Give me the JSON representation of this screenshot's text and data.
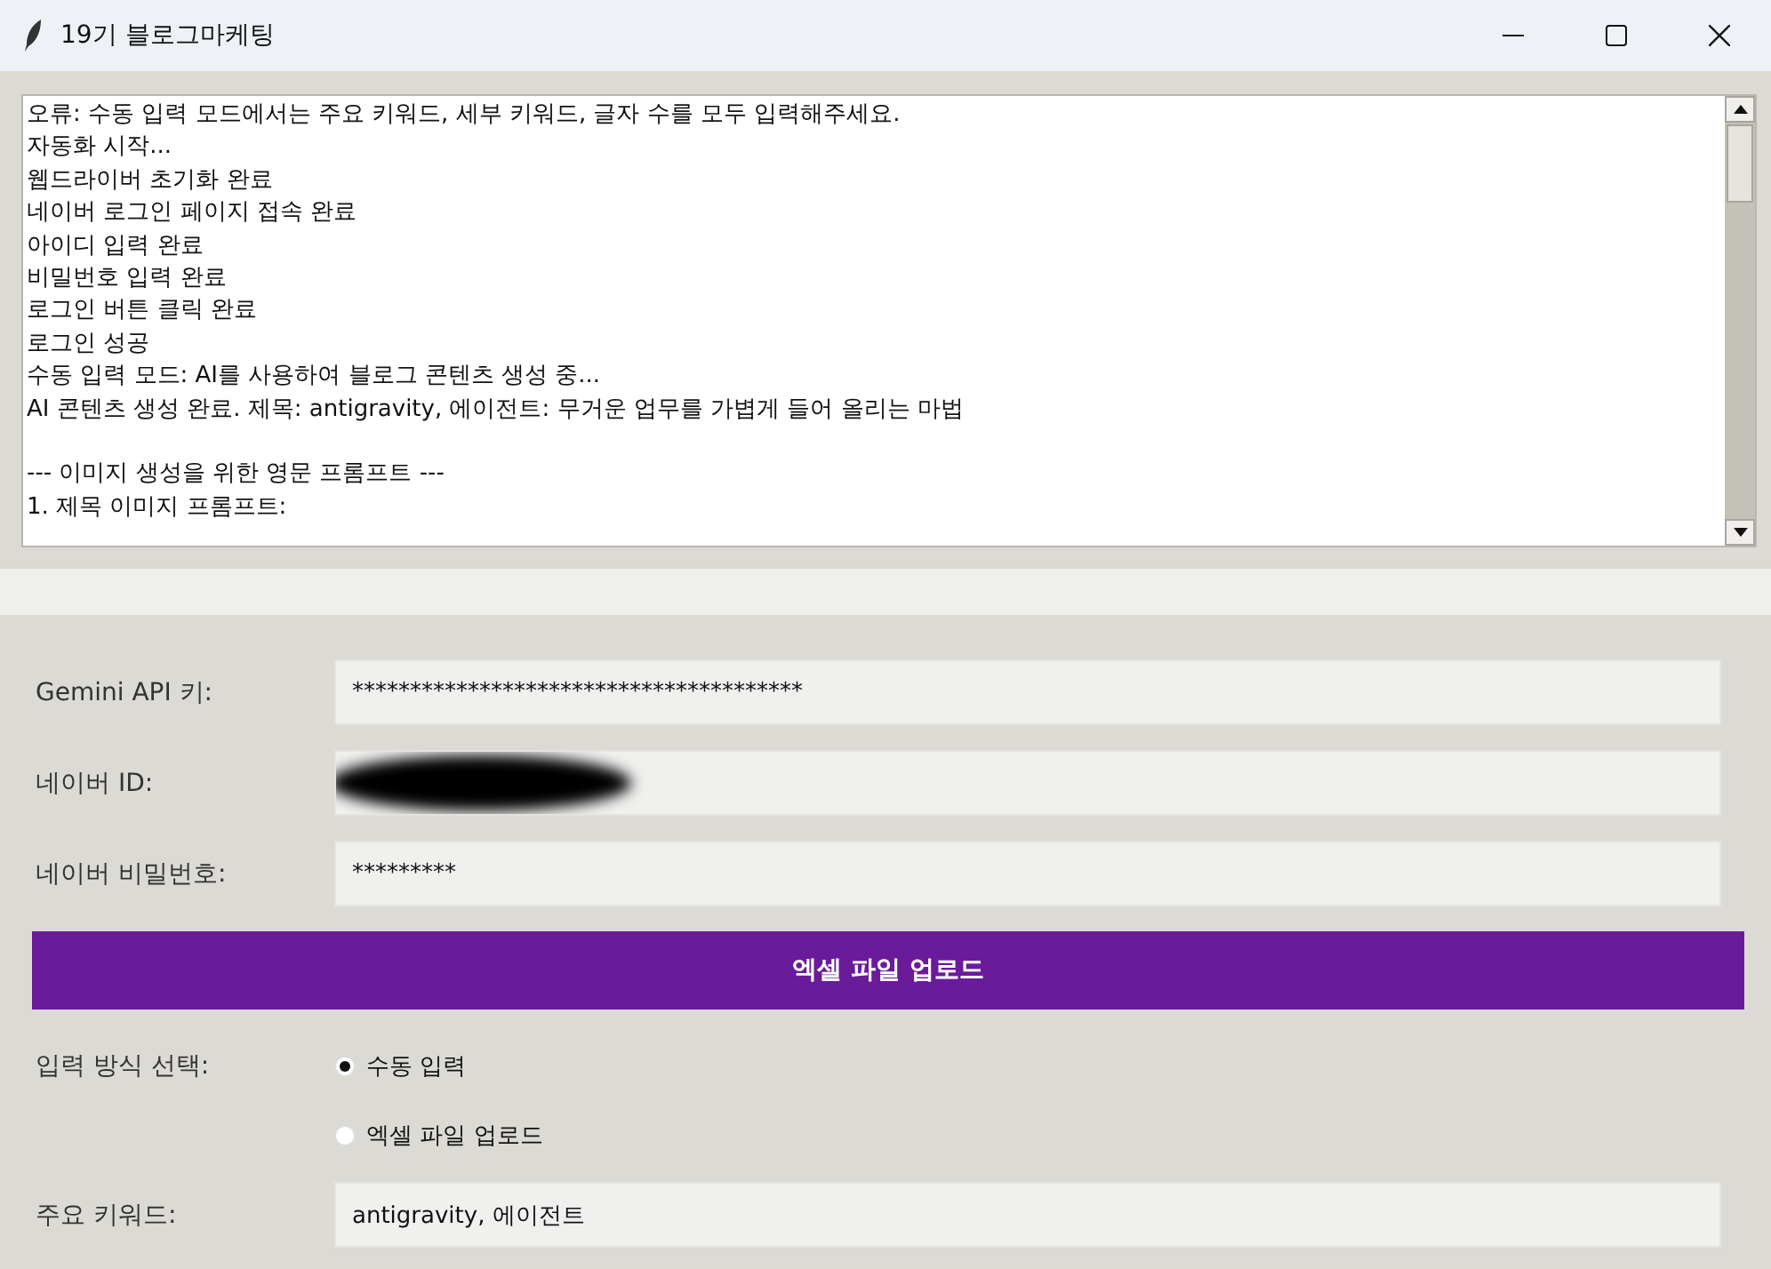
{
  "window": {
    "title": "19기 블로그마케팅"
  },
  "log": {
    "blocks": [
      [
        "오류: 수동 입력 모드에서는 주요 키워드, 세부 키워드, 글자 수를 모두 입력해주세요.",
        "자동화 시작...",
        "웹드라이버 초기화 완료",
        "네이버 로그인 페이지 접속 완료",
        "아이디 입력 완료",
        "비밀번호 입력 완료",
        "로그인 버튼 클릭 완료",
        "로그인 성공",
        "수동 입력 모드: AI를 사용하여 블로그 콘텐츠 생성 중...",
        "AI 콘텐츠 생성 완료. 제목: antigravity, 에이전트: 무거운 업무를 가볍게 들어 올리는 마법"
      ],
      [
        "--- 이미지 생성을 위한 영문 프롬프트 ---",
        "1. 제목 이미지 프롬프트:"
      ]
    ]
  },
  "fields": [
    {
      "label": "Gemini API 키:",
      "value": "***************************************"
    },
    {
      "label": "네이버 ID:",
      "redacted": true
    },
    {
      "label": "네이버 비밀번호:",
      "value": "*********"
    }
  ],
  "upload_button": "엑셀 파일 업로드",
  "input_mode": {
    "label": "입력 방식 선택:",
    "options": [
      {
        "label": "수동 입력",
        "selected": true
      },
      {
        "label": "엑셀 파일 업로드",
        "selected": false
      }
    ]
  },
  "keyword": {
    "label": "주요 키워드:",
    "value": "antigravity, 에이전트"
  }
}
